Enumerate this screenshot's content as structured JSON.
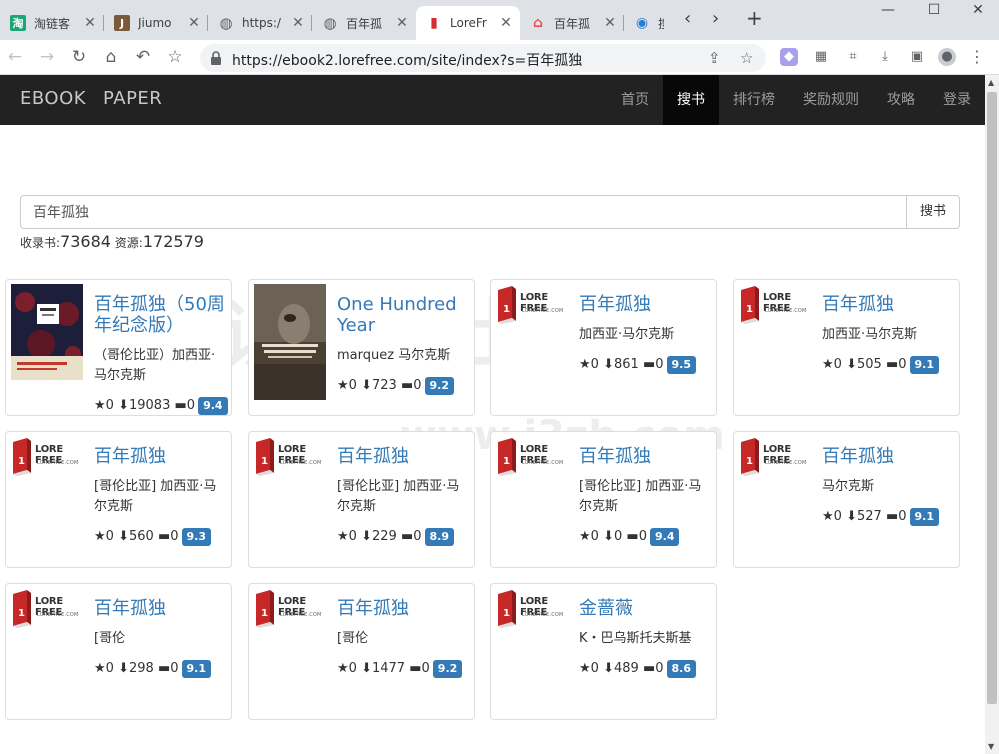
{
  "browser": {
    "tabs": [
      {
        "title": "淘链客",
        "favicon_text": "淘",
        "favicon_color": "#1da57a"
      },
      {
        "title": "Jiumo",
        "favicon_text": "J",
        "favicon_color": "#7a5a3a"
      },
      {
        "title": "https:/",
        "favicon_text": "◍",
        "favicon_color": "#5f6368"
      },
      {
        "title": "百年孤",
        "favicon_text": "◍",
        "favicon_color": "#5f6368"
      },
      {
        "title": "LoreFr",
        "favicon_text": "▮",
        "favicon_color": "#d32f2f"
      },
      {
        "title": "百年孤",
        "favicon_text": "⌂",
        "favicon_color": "#e55353"
      },
      {
        "title": "搜",
        "favicon_text": "◉",
        "favicon_color": "#2680d8"
      }
    ],
    "url": "https://ebook2.lorefree.com/site/index?s=百年孤独"
  },
  "navbar": {
    "brand_ebook": "EBOOK",
    "brand_paper": "PAPER",
    "menu": [
      "首页",
      "搜书",
      "排行榜",
      "奖励规则",
      "攻略",
      "登录"
    ],
    "active_menu": "搜书"
  },
  "search": {
    "value": "百年孤独",
    "button_label": "搜书",
    "books_label": "收录书:",
    "books_count": "73684",
    "resources_label": "资源:",
    "resources_count": "172579"
  },
  "logo": {
    "name": "LORE FREE",
    "domain": "LOREFREE.COM",
    "color": "#c62828"
  },
  "books": [
    {
      "title": "百年孤独（50周年纪念版）",
      "author": "（哥伦比亚）加西亚·马尔克斯",
      "stars": "0",
      "downloads": "19083",
      "comments": "0",
      "score": "9.4",
      "cover": "red-cover"
    },
    {
      "title": "One Hundred Year",
      "author": "marquez 马尔克斯",
      "stars": "0",
      "downloads": "723",
      "comments": "0",
      "score": "9.2",
      "cover": "photo-cover"
    },
    {
      "title": "百年孤独",
      "author": "加西亚·马尔克斯",
      "stars": "0",
      "downloads": "861",
      "comments": "0",
      "score": "9.5",
      "cover": "logo"
    },
    {
      "title": "百年孤独",
      "author": "加西亚·马尔克斯",
      "stars": "0",
      "downloads": "505",
      "comments": "0",
      "score": "9.1",
      "cover": "logo"
    },
    {
      "title": "百年孤独",
      "author": "[哥伦比亚] 加西亚·马尔克斯",
      "stars": "0",
      "downloads": "560",
      "comments": "0",
      "score": "9.3",
      "cover": "logo"
    },
    {
      "title": "百年孤独",
      "author": "[哥伦比亚] 加西亚·马尔克斯",
      "stars": "0",
      "downloads": "229",
      "comments": "0",
      "score": "8.9",
      "cover": "logo"
    },
    {
      "title": "百年孤独",
      "author": "[哥伦比亚] 加西亚·马尔克斯",
      "stars": "0",
      "downloads": "0",
      "comments": "0",
      "score": "9.4",
      "cover": "logo"
    },
    {
      "title": "百年孤独",
      "author": "马尔克斯",
      "stars": "0",
      "downloads": "527",
      "comments": "0",
      "score": "9.1",
      "cover": "logo"
    },
    {
      "title": "百年孤独",
      "author": "[哥伦",
      "stars": "0",
      "downloads": "298",
      "comments": "0",
      "score": "9.1",
      "cover": "logo"
    },
    {
      "title": "百年孤独",
      "author": "[哥伦",
      "stars": "0",
      "downloads": "1477",
      "comments": "0",
      "score": "9.2",
      "cover": "logo"
    },
    {
      "title": "金蔷薇",
      "author": "K・巴乌斯托夫斯基",
      "stars": "0",
      "downloads": "489",
      "comments": "0",
      "score": "8.6",
      "cover": "logo"
    }
  ],
  "watermark": {
    "line1": "识综合社区",
    "line2": "www.i3zh.com"
  },
  "colors": {
    "link": "#337ab7",
    "badge": "#337ab7",
    "navbar": "#222222"
  }
}
